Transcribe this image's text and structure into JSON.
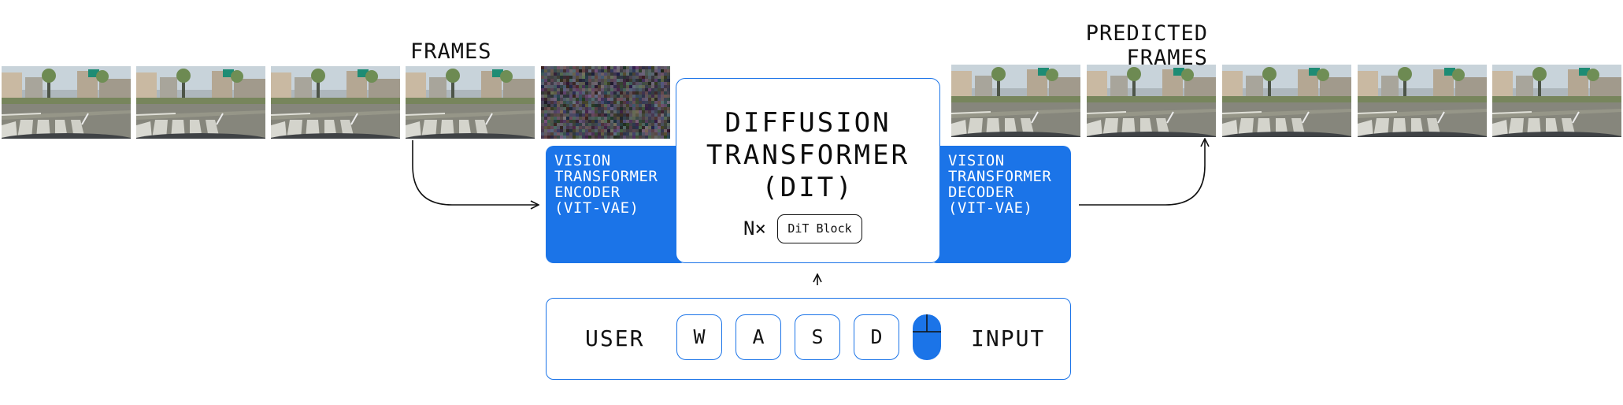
{
  "labels": {
    "frames": "FRAMES",
    "predicted_line1": "PREDICTED",
    "predicted_line2": "FRAMES"
  },
  "encoder": {
    "text": "VISION\nTRANSFORMER\nENCODER\n(VIT-VAE)"
  },
  "dit": {
    "title": "DIFFUSION\nTRANSFORMER\n(DIT)",
    "multiplier": "N×",
    "block_label": "DiT Block"
  },
  "decoder": {
    "text": "VISION\nTRANSFORMER\nDECODER\n(VIT-VAE)"
  },
  "user_input": {
    "left_label": "USER",
    "keys": [
      "W",
      "A",
      "S",
      "D"
    ],
    "right_label": "INPUT",
    "mouse_icon": "mouse-icon"
  },
  "colors": {
    "accent": "#1b74e8",
    "text": "#111111"
  }
}
